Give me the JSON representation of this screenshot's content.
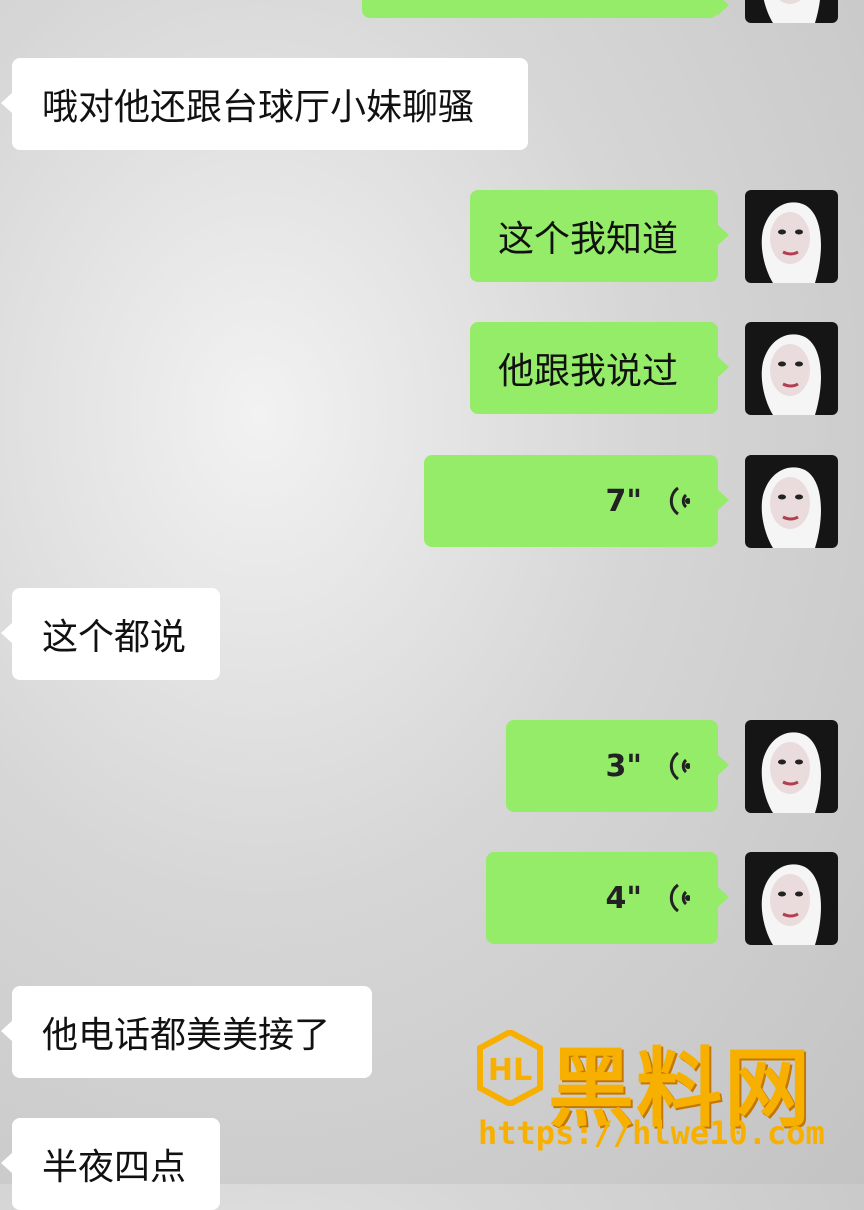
{
  "messages": [
    {
      "id": "m0",
      "side": "out",
      "type": "text",
      "text": ""
    },
    {
      "id": "m1",
      "side": "in",
      "type": "text",
      "text": "哦对他还跟台球厅小妹聊骚"
    },
    {
      "id": "m2",
      "side": "out",
      "type": "text",
      "text": "这个我知道"
    },
    {
      "id": "m3",
      "side": "out",
      "type": "text",
      "text": "他跟我说过"
    },
    {
      "id": "m4",
      "side": "out",
      "type": "voice",
      "duration": "7\""
    },
    {
      "id": "m5",
      "side": "in",
      "type": "text",
      "text": "这个都说"
    },
    {
      "id": "m6",
      "side": "out",
      "type": "voice",
      "duration": "3\""
    },
    {
      "id": "m7",
      "side": "out",
      "type": "voice",
      "duration": "4\""
    },
    {
      "id": "m8",
      "side": "in",
      "type": "text",
      "text": "他电话都美美接了"
    },
    {
      "id": "m9",
      "side": "in",
      "type": "text",
      "text": "半夜四点"
    }
  ],
  "watermark": {
    "logo": "HL",
    "title": "黑料网",
    "url": "https://hlwe10.com"
  },
  "colors": {
    "outgoing_bubble": "#95ec69",
    "incoming_bubble": "#ffffff",
    "watermark": "#f7b000"
  },
  "icons": {
    "voice": "voice-wave-icon",
    "avatar": "user-avatar"
  }
}
